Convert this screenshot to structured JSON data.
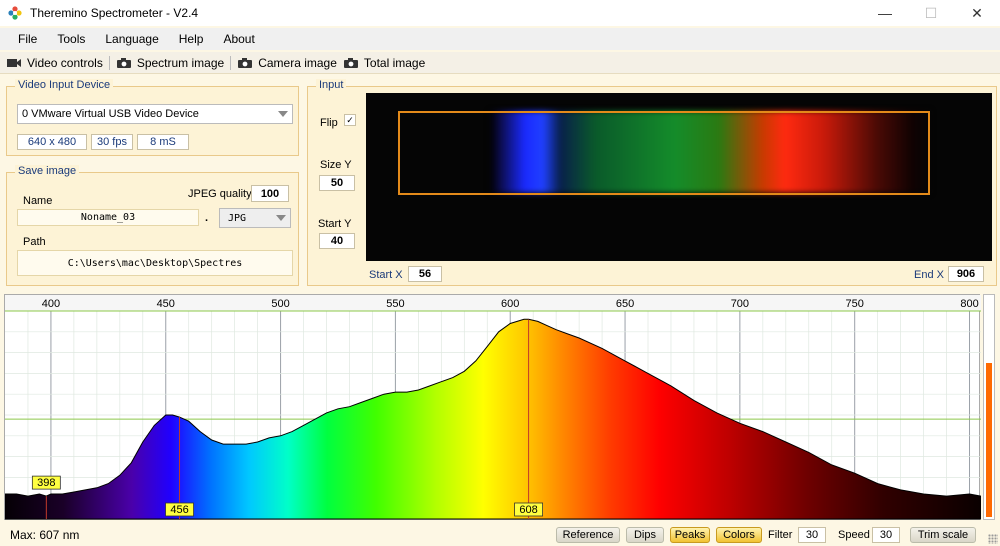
{
  "window": {
    "title": "Theremino Spectrometer - V2.4",
    "minimize": "—",
    "maximize": "☐",
    "close": "✕"
  },
  "menu": [
    "File",
    "Tools",
    "Language",
    "Help",
    "About"
  ],
  "toolbar": {
    "video_controls": "Video controls",
    "spectrum_image": "Spectrum image",
    "camera_image": "Camera image",
    "total_image": "Total image"
  },
  "video_input": {
    "legend": "Video Input Device",
    "device": "0 VMware Virtual USB Video Device",
    "resolution": "640 x 480",
    "fps": "30 fps",
    "exposure": "8 mS"
  },
  "save_image": {
    "legend": "Save image",
    "name_label": "Name",
    "name_value": "Noname_03",
    "jpeg_quality_label": "JPEG quality",
    "jpeg_quality": "100",
    "dot": ".",
    "format": "JPG",
    "path_label": "Path",
    "path_value": "C:\\Users\\mac\\Desktop\\Spectres"
  },
  "input": {
    "legend": "Input",
    "flip_label": "Flip",
    "flip_checked": "✓",
    "size_y_label": "Size Y",
    "size_y": "50",
    "start_y_label": "Start Y",
    "start_y": "40",
    "start_x_label": "Start X",
    "start_x": "56",
    "end_x_label": "End X",
    "end_x": "906"
  },
  "chart_data": {
    "type": "area",
    "xlim": [
      380,
      805
    ],
    "ylim": [
      0,
      100
    ],
    "x_ticks": [
      400,
      450,
      500,
      550,
      600,
      650,
      700,
      750,
      800
    ],
    "grid": true,
    "x": [
      380,
      385,
      390,
      395,
      398,
      400,
      405,
      410,
      415,
      420,
      425,
      430,
      435,
      440,
      445,
      450,
      453,
      456,
      460,
      465,
      470,
      475,
      480,
      485,
      490,
      495,
      500,
      505,
      510,
      515,
      520,
      525,
      530,
      535,
      540,
      545,
      550,
      555,
      560,
      565,
      570,
      575,
      580,
      585,
      590,
      595,
      600,
      603,
      606,
      608,
      612,
      616,
      620,
      625,
      630,
      640,
      650,
      660,
      670,
      680,
      690,
      700,
      710,
      720,
      730,
      740,
      750,
      760,
      770,
      780,
      790,
      800,
      805
    ],
    "y": [
      12,
      12,
      11,
      12,
      11,
      12,
      12,
      13,
      14,
      15,
      17,
      21,
      27,
      37,
      45,
      50,
      50,
      49,
      47,
      42,
      38,
      36,
      36,
      36,
      37,
      39,
      40,
      42,
      45,
      48,
      51,
      53,
      54,
      56,
      58,
      60,
      61,
      61,
      62,
      64,
      66,
      68,
      71,
      76,
      83,
      90,
      94,
      95,
      96,
      96,
      95,
      93,
      91,
      89,
      87,
      82,
      76,
      70,
      64,
      57,
      51,
      46,
      42,
      37,
      32,
      26,
      22,
      17,
      14,
      12,
      11,
      12,
      11
    ],
    "peak_markers": [
      {
        "label": "398",
        "x": 398,
        "y": 11
      },
      {
        "label": "456",
        "x": 456,
        "y": 49
      },
      {
        "label": "608",
        "x": 608,
        "y": 96
      }
    ],
    "reference_line_y": 48
  },
  "status": {
    "max_text": "Max: 607 nm",
    "reference": "Reference",
    "dips": "Dips",
    "peaks": "Peaks",
    "colors": "Colors",
    "filter_label": "Filter",
    "filter_value": "30",
    "speed_label": "Speed",
    "speed_value": "30",
    "trim_scale": "Trim scale"
  },
  "side_level": 0.7,
  "colors": {
    "accent_orange": "#e38a1a",
    "peak_line": "#c0392b",
    "label_blue": "#1a3a7a"
  },
  "icons": {
    "app": "flower-icon",
    "video": "video-camera-icon",
    "camera": "camera-icon"
  }
}
